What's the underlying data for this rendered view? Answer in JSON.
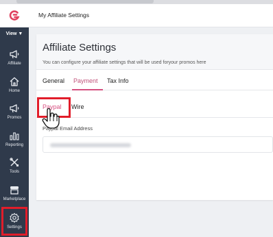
{
  "header": {
    "title": "My Affiliate Settings"
  },
  "sidebar": {
    "view_label": "View ▼",
    "items": [
      {
        "label": "Affiliate",
        "icon": "megaphone-icon"
      },
      {
        "label": "Home",
        "icon": "home-icon"
      },
      {
        "label": "Promos",
        "icon": "megaphone-icon"
      },
      {
        "label": "Reporting",
        "icon": "bar-chart-icon"
      },
      {
        "label": "Tools",
        "icon": "tools-icon"
      },
      {
        "label": "Marketplace",
        "icon": "store-icon"
      },
      {
        "label": "Settings",
        "icon": "gear-icon"
      }
    ]
  },
  "main": {
    "title": "Affiliate Settings",
    "subtitle": "You can configure your affiliate settings that will be used foryour promos here",
    "tabs": [
      {
        "label": "General"
      },
      {
        "label": "Payment",
        "active": true
      },
      {
        "label": "Tax Info"
      }
    ],
    "subtabs": [
      {
        "label": "Paypal",
        "active": true
      },
      {
        "label": "Wire"
      }
    ],
    "field_label": "Paypal Email Address"
  },
  "colors": {
    "sidebar": "#2f3a4b",
    "accent": "#d44f7f",
    "highlight": "#e11d2a",
    "logo": "#e0405f"
  }
}
